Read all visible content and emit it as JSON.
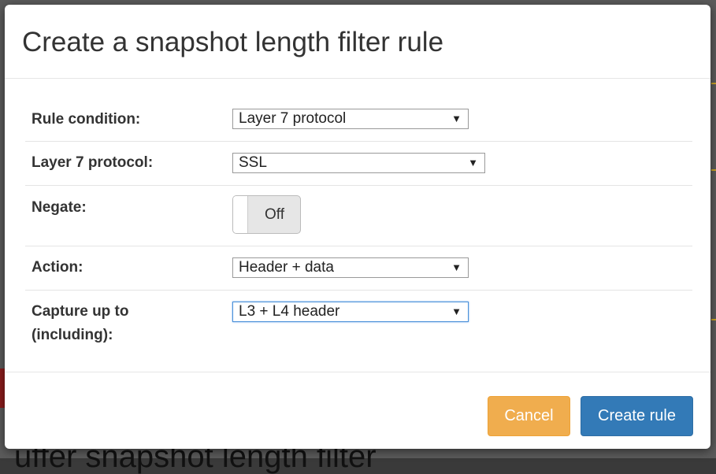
{
  "background": {
    "heading_fragment": "uffer snapshot length filter"
  },
  "modal": {
    "title": "Create a snapshot length filter rule",
    "rows": [
      {
        "label": "Rule condition:",
        "control": "select",
        "value": "Layer 7 protocol"
      },
      {
        "label": "Layer 7 protocol:",
        "control": "select",
        "value": "SSL"
      },
      {
        "label": "Negate:",
        "control": "toggle",
        "value": "Off"
      },
      {
        "label": "Action:",
        "control": "select",
        "value": "Header + data"
      },
      {
        "label_line1": "Capture up to",
        "label_line2": "(including):",
        "control": "select",
        "value": "L3 + L4 header"
      }
    ],
    "buttons": {
      "cancel": "Cancel",
      "create": "Create rule"
    }
  },
  "icons": {
    "dropdown_arrow": "▼"
  },
  "colors": {
    "cancel": "#f0ad4e",
    "primary": "#337ab7"
  }
}
